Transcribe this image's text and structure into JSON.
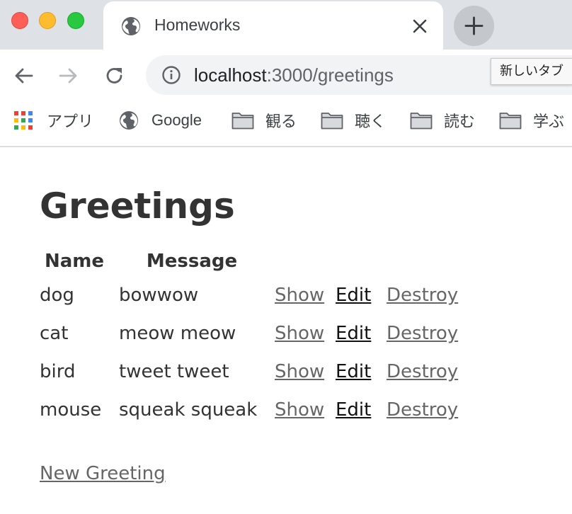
{
  "browser": {
    "tab_title": "Homeworks",
    "url_host": "localhost",
    "url_path": ":3000/greetings",
    "tooltip": "新しいタブ",
    "bookmarks": [
      {
        "label": "アプリ",
        "icon": "apps-grid-icon"
      },
      {
        "label": "Google",
        "icon": "globe-icon"
      },
      {
        "label": "観る",
        "icon": "folder-icon"
      },
      {
        "label": "聴く",
        "icon": "folder-icon"
      },
      {
        "label": "読む",
        "icon": "folder-icon"
      },
      {
        "label": "学ぶ",
        "icon": "folder-icon"
      }
    ]
  },
  "page": {
    "title": "Greetings",
    "table": {
      "headers": {
        "name": "Name",
        "message": "Message"
      },
      "rows": [
        {
          "name": "dog",
          "message": "bowwow",
          "show": "Show",
          "edit": "Edit",
          "destroy": "Destroy"
        },
        {
          "name": "cat",
          "message": "meow meow",
          "show": "Show",
          "edit": "Edit",
          "destroy": "Destroy"
        },
        {
          "name": "bird",
          "message": "tweet tweet",
          "show": "Show",
          "edit": "Edit",
          "destroy": "Destroy"
        },
        {
          "name": "mouse",
          "message": "squeak squeak",
          "show": "Show",
          "edit": "Edit",
          "destroy": "Destroy"
        }
      ]
    },
    "new_link": "New Greeting"
  },
  "colors": {
    "visited_link": "#666666",
    "edit_link": "#111111",
    "text": "#333333",
    "tabstrip": "#dee1e6"
  }
}
